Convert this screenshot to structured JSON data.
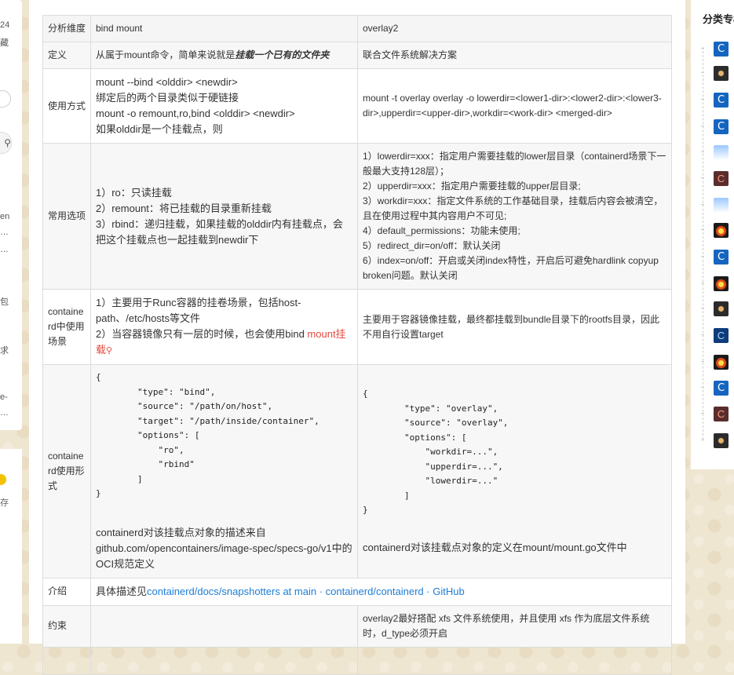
{
  "left_panel": {
    "frag_top": "24",
    "frag_collect": "藏",
    "frag_en": "en",
    "frag_dots1": "…",
    "frag_dots2": "…",
    "frag_bao": "包",
    "frag_qiu": "求",
    "frag_e": "e-",
    "frag_dots3": "…",
    "frag_cun": "存"
  },
  "table": {
    "headers": [
      "分析维度",
      "bind mount",
      "overlay2"
    ],
    "rows": {
      "definition": {
        "label": "定义",
        "bind_prefix": "从属于mount命令，简单来说就是",
        "bind_emph": "挂载一个已有的文件夹",
        "overlay": "联合文件系统解决方案"
      },
      "usage": {
        "label": "使用方式",
        "bind_lines": [
          "mount --bind <olddir> <newdir>",
          "绑定后的两个目录类似于硬链接",
          "mount -o remount,ro,bind <olddir> <newdir>",
          "如果olddir是一个挂载点，则"
        ],
        "overlay": "mount -t overlay overlay -o lowerdir=<lower1-dir>:<lower2-dir>:<lower3-dir>,upperdir=<upper-dir>,workdir=<work-dir> <merged-dir>"
      },
      "options": {
        "label": "常用选项",
        "bind_lines": [
          "1）ro：只读挂载",
          "2）remount：将已挂载的目录重新挂载",
          "3）rbind：递归挂载，如果挂载的olddir内有挂载点，会把这个挂载点也一起挂载到newdir下"
        ],
        "overlay_lines": [
          "1）lowerdir=xxx：指定用户需要挂载的lower层目录（containerd场景下一般最大支持128层）；",
          "2）upperdir=xxx：指定用户需要挂载的upper层目录;",
          "3）workdir=xxx：指定文件系统的工作基础目录，挂载后内容会被清空，且在使用过程中其内容用户不可见;",
          "4）default_permissions：功能未使用;",
          "5）redirect_dir=on/off：默认关闭",
          "6）index=on/off：开启或关闭index特性，开启后可避免hardlink copyup broken问题。默认关闭"
        ]
      },
      "scenario": {
        "label": "containerd中使用场景",
        "bind_line1": "1）主要用于Runc容器的挂卷场景，包括host-path、/etc/hosts等文件",
        "bind_line2_prefix": "2）当容器镜像只有一层的时候，也会使用bind ",
        "bind_link": "mount挂载",
        "overlay": "主要用于容器镜像挂载，最终都挂载到bundle目录下的rootfs目录，因此不用自行设置target"
      },
      "form": {
        "label": "containerd使用形式",
        "bind_code": "{\n        \"type\": \"bind\",\n        \"source\": \"/path/on/host\",\n        \"target\": \"/path/inside/container\",\n        \"options\": [\n            \"ro\",\n            \"rbind\"\n        ]\n}",
        "bind_desc": "containerd对该挂载点对象的描述来自github.com/opencontainers/image-spec/specs-go/v1中的OCI规范定义",
        "overlay_code": "{\n        \"type\": \"overlay\",\n        \"source\": \"overlay\",\n        \"options\": [\n            \"workdir=...\",\n            \"upperdir=...\",\n            \"lowerdir=...\"\n        ]\n}",
        "overlay_desc": "containerd对该挂载点对象的定义在mount/mount.go文件中"
      },
      "intro": {
        "label": "介绍",
        "prefix": "具体描述见",
        "link": "containerd/docs/snapshotters at main · containerd/containerd · GitHub"
      },
      "constraint": {
        "label": "约束",
        "bind": "",
        "overlay": "overlay2最好搭配 xfs 文件系统使用，并且使用 xfs 作为底层文件系统时，d_type必须开启"
      }
    }
  },
  "right_panel": {
    "title": "分类专栏",
    "thumb_icons": [
      "c-icon",
      "dark-icon",
      "c-icon",
      "c-icon",
      "sky-icon",
      "c-dark-icon",
      "sky-icon",
      "fire-icon",
      "c-icon",
      "fire-icon",
      "dark-icon",
      "c-blue-icon",
      "fire-icon",
      "c-icon",
      "c-dark-icon",
      "dark-icon"
    ],
    "c_glyph": "C"
  }
}
